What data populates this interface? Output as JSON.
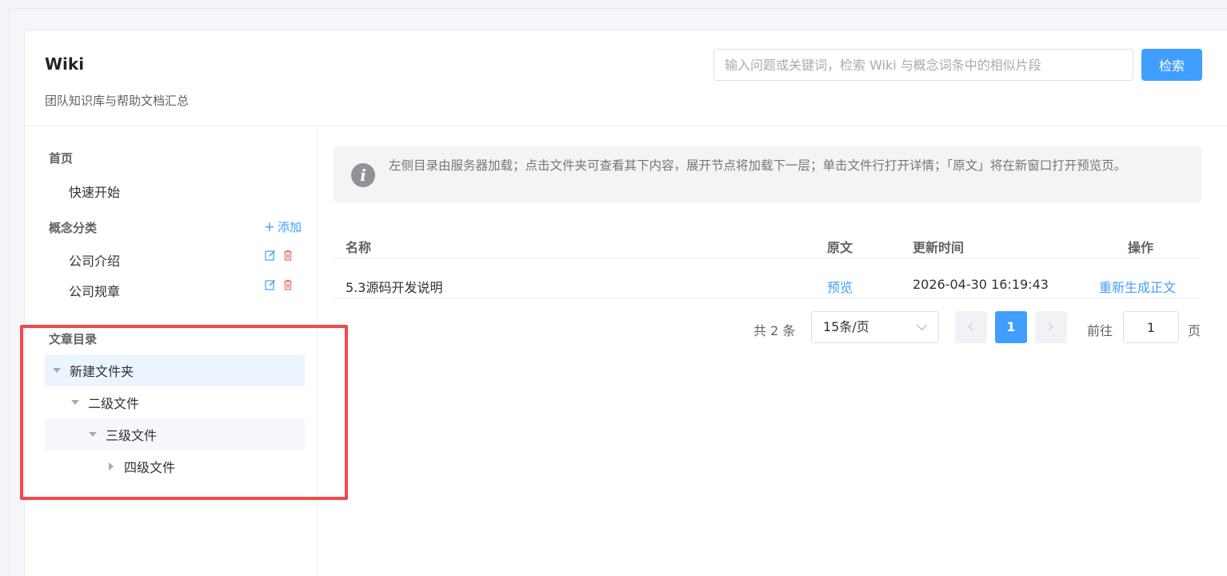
{
  "header": {
    "title": "Wiki",
    "subtitle": "团队知识库与帮助文档汇总",
    "search_placeholder": "输入问题或关键词，检索 Wiki 与概念词条中的相似片段",
    "search_label": "检索"
  },
  "sidebar": {
    "home_heading": "首页",
    "quick_start": "快速开始",
    "concept_heading": "概念分类",
    "add_label": "添加",
    "concepts": [
      "公司介绍",
      "公司规章"
    ],
    "catalog_heading": "文章目录",
    "tree": [
      {
        "label": "新建文件夹",
        "expanded": true,
        "selected": true
      },
      {
        "label": "二级文件",
        "expanded": true
      },
      {
        "label": "三级文件",
        "expanded": true
      },
      {
        "label": "四级文件",
        "expanded": false
      }
    ]
  },
  "notice": {
    "text": "左侧目录由服务器加载；点击文件夹可查看其下内容，展开节点将加载下一层；单击文件行打开详情；「原文」将在新窗口打开预览页。"
  },
  "table": {
    "columns": [
      "名称",
      "原文",
      "更新时间",
      "操作"
    ],
    "rows": [
      {
        "name": "5.3源码开发说明",
        "source": "预览",
        "updated": "2026-04-30 16:19:43",
        "action": "重新生成正文"
      }
    ]
  },
  "pagination": {
    "total": "共 2 条",
    "page_size": "15条/页",
    "current_page": "1",
    "goto_label": "前往",
    "goto_value": "1",
    "page_suffix": "页"
  },
  "colors": {
    "accent": "#409eff",
    "highlight_box": "#f04a4a",
    "delete": "#f56c6c"
  }
}
